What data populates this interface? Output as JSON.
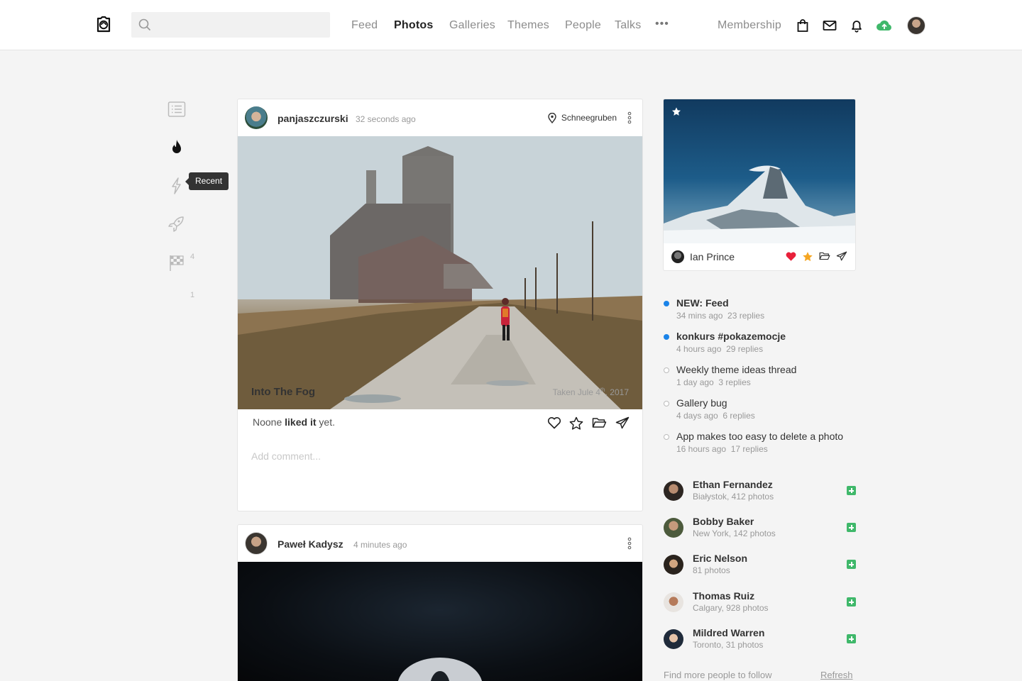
{
  "header": {
    "search": {
      "placeholder": ""
    },
    "nav": [
      {
        "label": "Feed",
        "active": false
      },
      {
        "label": "Photos",
        "active": true
      },
      {
        "label": "Galleries",
        "active": false
      },
      {
        "label": "Themes",
        "active": false
      },
      {
        "label": "People",
        "active": false
      },
      {
        "label": "Talks",
        "active": false
      }
    ],
    "more_label": "•••",
    "membership_label": "Membership",
    "icons": [
      "shopping-bag-icon",
      "mail-icon",
      "bell-icon",
      "upload-cloud-icon"
    ],
    "upload_color": "#3fb86a"
  },
  "left_rail": {
    "items": [
      "list-icon",
      "fire-icon",
      "lightning-icon",
      "rocket-icon",
      "checkered-flag-icon"
    ],
    "tooltip": "Recent",
    "flag_count": "4",
    "extra_count": "1"
  },
  "posts": [
    {
      "user": "panjaszczurski",
      "time": "32 seconds ago",
      "location": "Schneegruben",
      "title": "Into The Fog",
      "date_prefix": "Taken Jule 4",
      "date_sup": "th",
      "date_suffix": ", 2017",
      "likes_prefix": "Noone ",
      "likes_bold": "liked it",
      "likes_suffix": " yet.",
      "comment_placeholder": "Add comment..."
    },
    {
      "user": "Paweł Kadysz",
      "time": "4 minutes ago"
    }
  ],
  "featured": {
    "author": "Ian Prince",
    "heart_color": "#e8203a",
    "star_color": "#f5a623"
  },
  "topics": [
    {
      "title": "NEW: Feed",
      "time": "34 mins ago",
      "replies": "23 replies",
      "unread": true
    },
    {
      "title": "konkurs #pokazemocje",
      "time": "4 hours ago",
      "replies": "29 replies",
      "unread": true
    },
    {
      "title": "Weekly theme ideas thread",
      "time": "1 day ago",
      "replies": "3 replies",
      "unread": false
    },
    {
      "title": "Gallery bug",
      "time": "4 days ago",
      "replies": "6 replies",
      "unread": false
    },
    {
      "title": "App makes too easy to delete a photo",
      "time": "16 hours ago",
      "replies": "17 replies",
      "unread": false
    }
  ],
  "people": [
    {
      "name": "Ethan Fernandez",
      "meta": "Białystok, 412 photos"
    },
    {
      "name": "Bobby Baker",
      "meta": "New York, 142 photos"
    },
    {
      "name": "Eric Nelson",
      "meta": "81 photos"
    },
    {
      "name": "Thomas Ruiz",
      "meta": "Calgary, 928 photos"
    },
    {
      "name": "Mildred Warren",
      "meta": "Toronto, 31 photos"
    }
  ],
  "footer": {
    "find_more": "Find more people to follow",
    "refresh": "Refresh"
  },
  "colors": {
    "accent_blue": "#1a83e8",
    "follow_green": "#3fb86a"
  }
}
